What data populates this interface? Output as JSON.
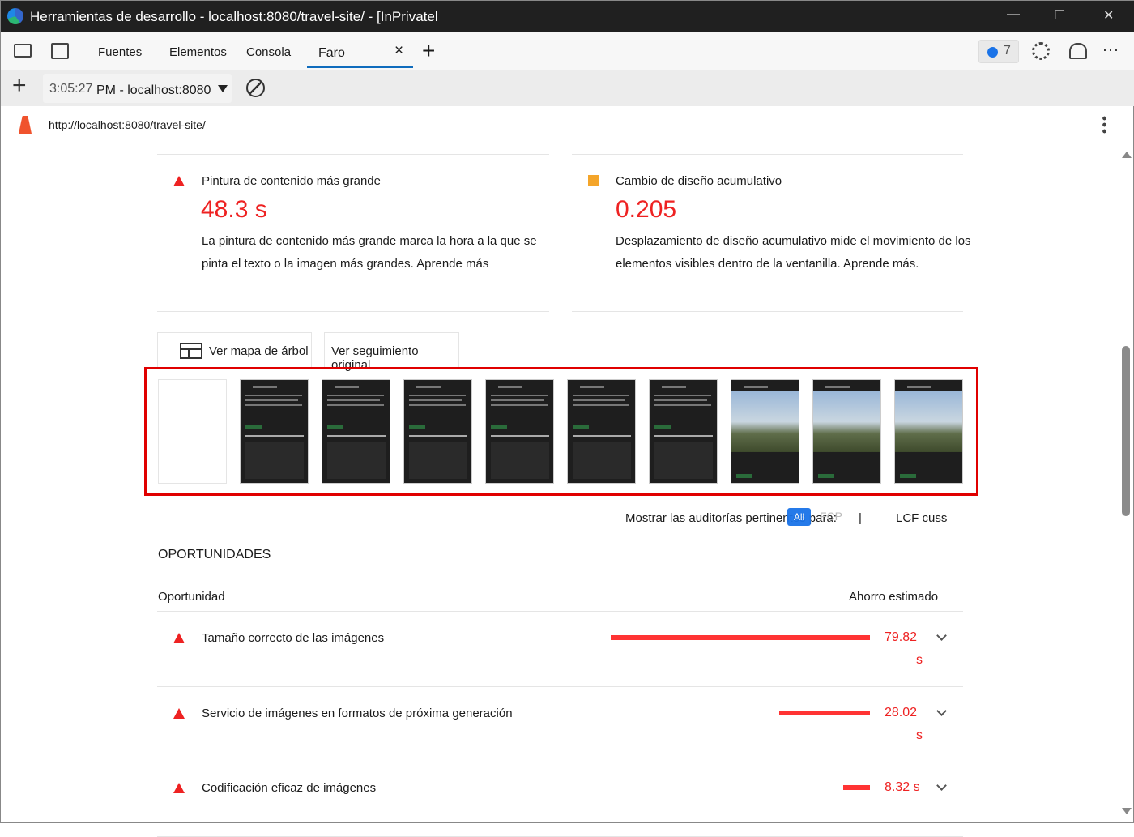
{
  "window": {
    "title": "Herramientas de desarrollo - localhost:8080/travel-site/ - [InPrivatel",
    "minimize": "—",
    "maximize": "☐",
    "close": "✕"
  },
  "tabs": [
    {
      "label": "Fuentes"
    },
    {
      "label": "Elementos"
    },
    {
      "label": "Consola"
    },
    {
      "label": "Faro",
      "active": true
    }
  ],
  "tab_close": "×",
  "tab_add": "+",
  "issues_count": "7",
  "more": "···",
  "toolbar": {
    "add": "+",
    "report_time": "3:05:27",
    "report_rest": "PM - localhost:8080"
  },
  "url": "http://localhost:8080/travel-site/",
  "metrics": [
    {
      "title": "Pintura de contenido más grande",
      "value": "48.3 s",
      "status": "fail",
      "desc": "La pintura de contenido más grande marca la hora a la que se pinta el texto o la imagen más grandes. Aprende más"
    },
    {
      "title": "Cambio de diseño acumulativo",
      "value": "0.205",
      "status": "average",
      "desc": "Desplazamiento de diseño acumulativo mide el movimiento de los elementos visibles dentro de la ventanilla. Aprende más."
    }
  ],
  "buttons": {
    "treemap": "Ver mapa de árbol",
    "trace": "Ver seguimiento original"
  },
  "filmstrip": {
    "frames": [
      "blank",
      "dark",
      "dark",
      "dark",
      "dark",
      "dark",
      "dark",
      "photo",
      "photo",
      "photo"
    ]
  },
  "filter": {
    "label": "Mostrar las auditorías pertinentes para:",
    "all": "All",
    "fcp": "FCP",
    "sep": "|",
    "lcp": "LCF cuss"
  },
  "opportunities": {
    "heading": "OPORTUNIDADES",
    "col_opportunity": "Oportunidad",
    "col_savings": "Ahorro estimado",
    "items": [
      {
        "title": "Tamaño correcto de las imágenes",
        "value": "79.82",
        "unit": "s",
        "fraction": 1.0
      },
      {
        "title": "Servicio de imágenes en formatos de próxima generación",
        "value": "28.02",
        "unit": "s",
        "fraction": 0.35
      },
      {
        "title": "Codificación eficaz de imágenes",
        "value": "8.32 s",
        "unit": "",
        "fraction": 0.104
      }
    ]
  },
  "colors": {
    "fail": "#e22222",
    "average": "#f4a52a",
    "accent": "#0f6cbd",
    "highlight": "#e00000"
  }
}
